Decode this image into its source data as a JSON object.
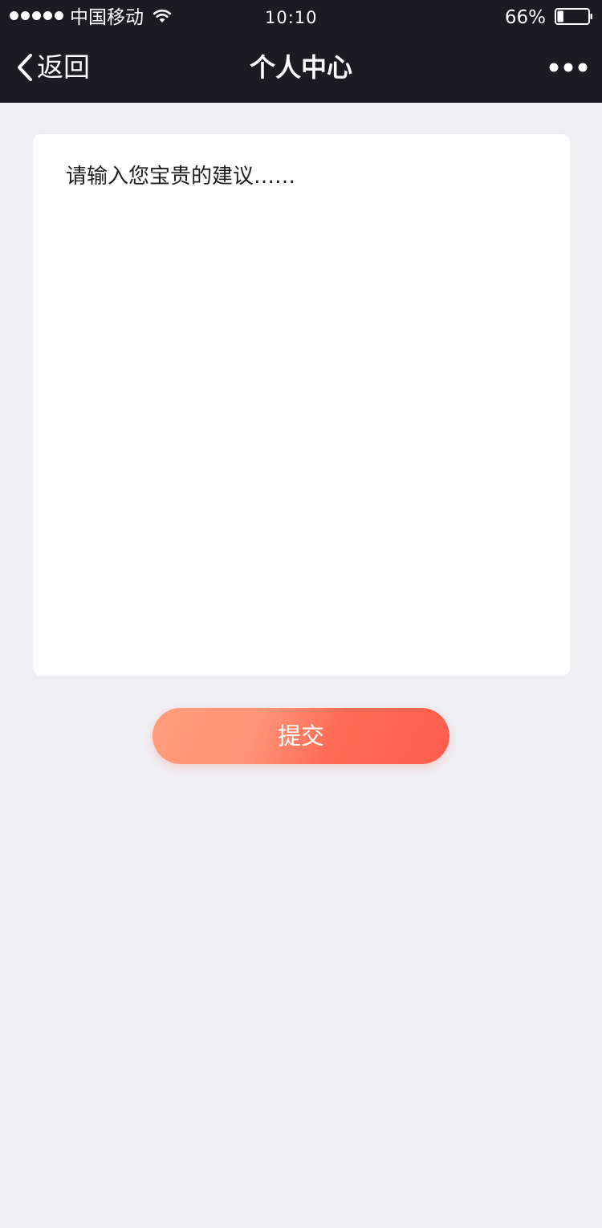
{
  "status_bar": {
    "carrier": "中国移动",
    "time": "10:10",
    "battery": "66%",
    "battery_level": 0.2,
    "signal_dots": 5,
    "icons": {
      "signal": "signal-dots-icon",
      "wifi": "wifi-icon",
      "battery": "battery-icon"
    }
  },
  "nav": {
    "back_label": "返回",
    "title": "个人中心",
    "icons": {
      "back": "chevron-left-icon",
      "more": "more-dots-icon"
    }
  },
  "feedback": {
    "placeholder": "请输入您宝贵的建议……",
    "value": ""
  },
  "submit": {
    "label": "提交"
  },
  "colors": {
    "bar_background": "#1c1b21",
    "page_background": "#efeef3",
    "card_background": "#ffffff",
    "button_gradient_start": "#ff9d7a",
    "button_gradient_end": "#ff5d4e",
    "text_on_dark": "#ffffff"
  }
}
